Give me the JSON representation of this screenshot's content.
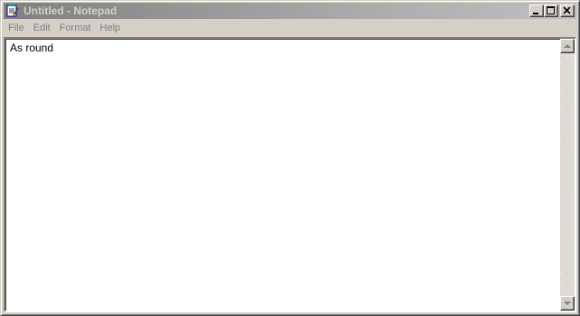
{
  "window": {
    "title": "Untitled - Notepad",
    "icon": "notepad-icon",
    "controls": [
      "minimize-icon",
      "maximize-icon",
      "close-icon"
    ]
  },
  "menu": {
    "items": [
      {
        "label": "File"
      },
      {
        "label": "Edit"
      },
      {
        "label": "Format"
      },
      {
        "label": "Help"
      }
    ]
  },
  "editor": {
    "text": "As round"
  },
  "scrollbar": {
    "up_icon": "arrow-up-icon",
    "down_icon": "arrow-down-icon"
  },
  "colors": {
    "titlebar_inactive_start": "#808080",
    "titlebar_inactive_end": "#c0c0c0",
    "title_text": "#d4d0c8",
    "face": "#d4d0c8"
  }
}
